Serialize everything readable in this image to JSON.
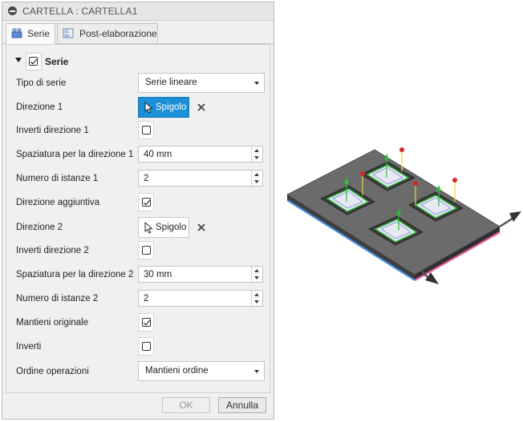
{
  "dialog": {
    "title": "CARTELLA : CARTELLA1",
    "tabs": [
      {
        "label": "Serie",
        "icon": "pattern-tab-icon"
      },
      {
        "label": "Post-elaborazione",
        "icon": "post-processing-tab-icon"
      }
    ],
    "group": {
      "label": "Serie",
      "checked": true
    },
    "fields": {
      "pattern_type": {
        "label": "Tipo di serie",
        "value": "Serie lineare"
      },
      "direction1": {
        "label": "Direzione 1",
        "button": "Spigolo",
        "active": true
      },
      "invert_direction1": {
        "label": "Inverti direzione 1",
        "checked": false
      },
      "spacing1": {
        "label": "Spaziatura per la direzione 1",
        "value": "40 mm"
      },
      "count1": {
        "label": "Numero di istanze 1",
        "value": "2"
      },
      "extra_direction": {
        "label": "Direzione aggiuntiva",
        "checked": true
      },
      "direction2": {
        "label": "Direzione 2",
        "button": "Spigolo",
        "active": false
      },
      "invert_direction2": {
        "label": "Inverti direzione 2",
        "checked": false
      },
      "spacing2": {
        "label": "Spaziatura per la direzione 2",
        "value": "30 mm"
      },
      "count2": {
        "label": "Numero di istanze 2",
        "value": "2"
      },
      "keep_original": {
        "label": "Mantieni originale",
        "checked": true
      },
      "invert": {
        "label": "Inverti",
        "checked": false
      },
      "operation_order": {
        "label": "Ordine operazioni",
        "value": "Mantieni ordine"
      }
    },
    "footer": {
      "ok": "OK",
      "cancel": "Annulla",
      "ok_enabled": false
    }
  },
  "colors": {
    "accent": "#1c8fd6",
    "plate_top": "#6b6b6b",
    "edge_direction1": "#4a90e2",
    "edge_direction2": "#e0569a",
    "toolpath": "#2fbf3a"
  }
}
